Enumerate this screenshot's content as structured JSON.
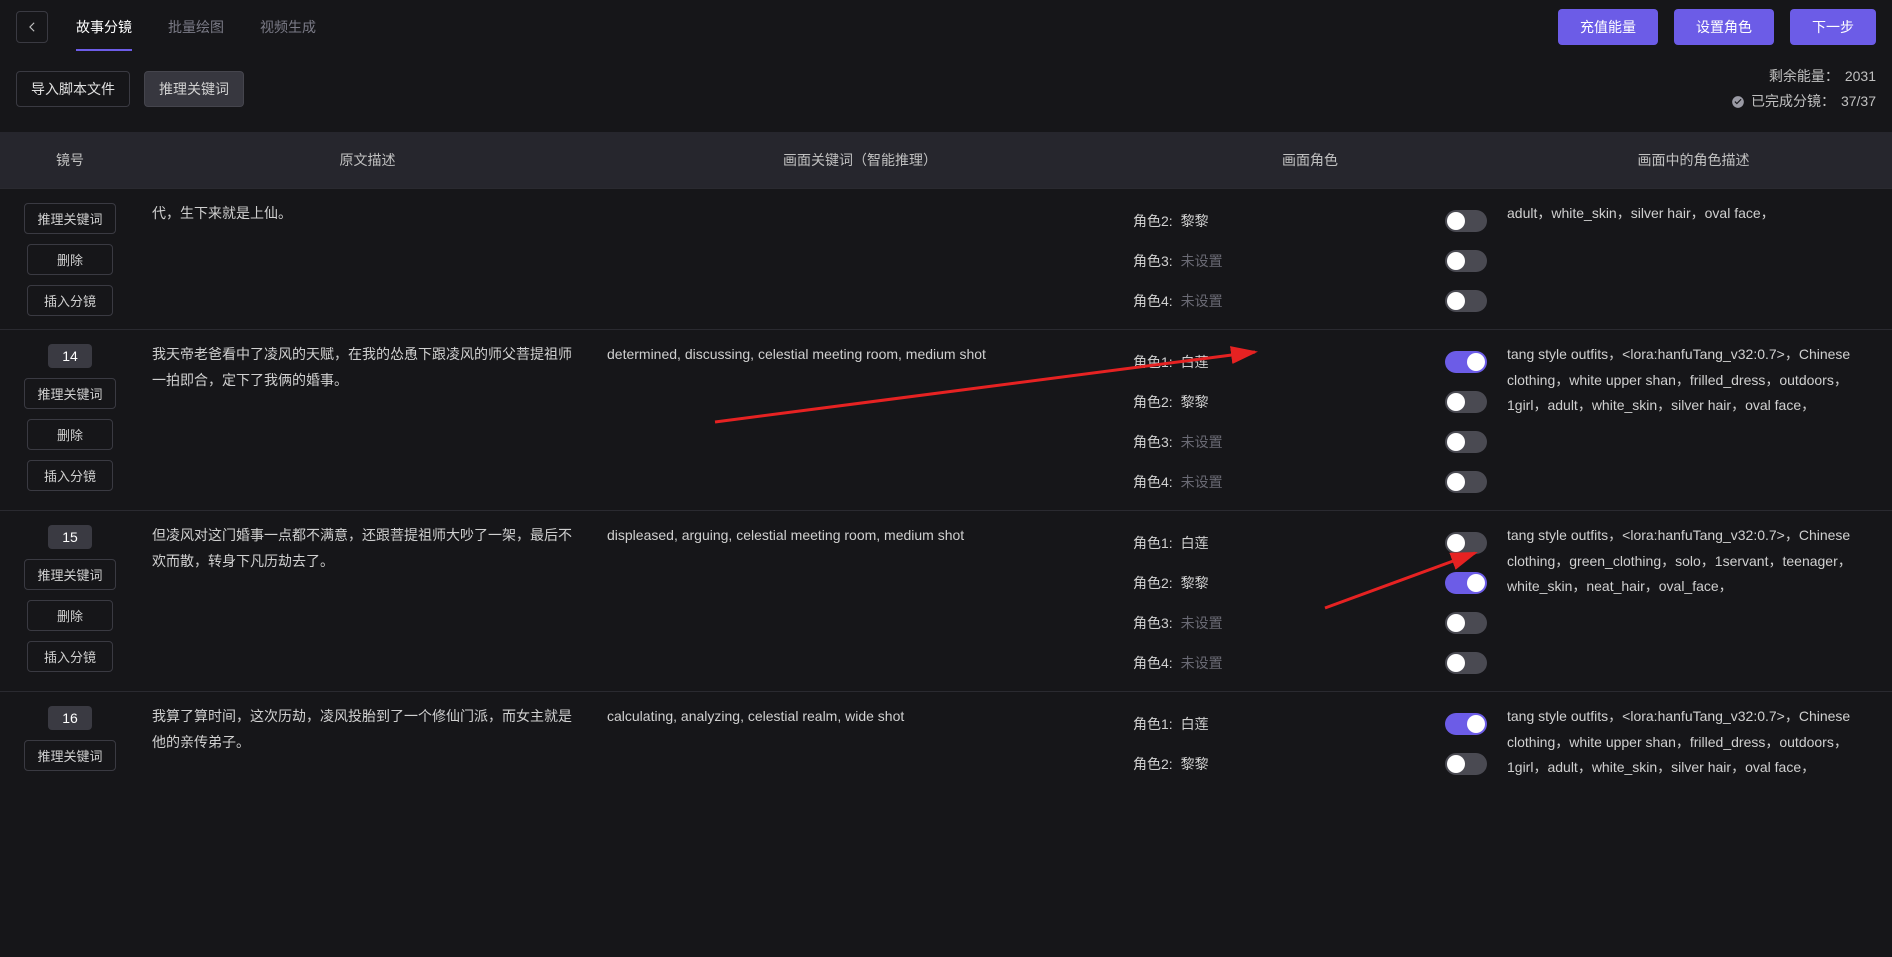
{
  "header": {
    "tabs": [
      "故事分镜",
      "批量绘图",
      "视频生成"
    ],
    "active_tab": 0,
    "buttons": {
      "recharge": "充值能量",
      "set_role": "设置角色",
      "next": "下一步"
    }
  },
  "subbar": {
    "import": "导入脚本文件",
    "infer": "推理关键词",
    "energy_label": "剩余能量：",
    "energy_value": "2031",
    "done_label": "已完成分镜：",
    "done_value": "37/37"
  },
  "columns": {
    "id": "镜号",
    "orig": "原文描述",
    "kw": "画面关键词（智能推理）",
    "role": "画面角色",
    "desc": "画面中的角色描述"
  },
  "row_buttons": {
    "infer": "推理关键词",
    "delete": "删除",
    "insert": "插入分镜"
  },
  "role_labels": {
    "prefix": "角色",
    "unset": "未设置"
  },
  "rows": [
    {
      "id": "",
      "partial_top": true,
      "orig": "代，生下来就是上仙。",
      "kw": "",
      "roles": [
        {
          "idx": 2,
          "name": "黎黎",
          "on": false
        },
        {
          "idx": 3,
          "name": "",
          "on": false
        },
        {
          "idx": 4,
          "name": "",
          "on": false
        }
      ],
      "desc": "adult，white_skin，silver hair，oval face，"
    },
    {
      "id": "14",
      "orig": "我天帝老爸看中了凌风的天赋，在我的怂恿下跟凌风的师父菩提祖师一拍即合，定下了我俩的婚事。",
      "kw": "determined, discussing, celestial meeting room, medium shot",
      "roles": [
        {
          "idx": 1,
          "name": "白莲",
          "on": true
        },
        {
          "idx": 2,
          "name": "黎黎",
          "on": false
        },
        {
          "idx": 3,
          "name": "",
          "on": false
        },
        {
          "idx": 4,
          "name": "",
          "on": false
        }
      ],
      "desc": "tang style outfits，<lora:hanfuTang_v32:0.7>，Chinese clothing，white upper shan，frilled_dress，outdoors，1girl，adult，white_skin，silver hair，oval face，",
      "arrow1": true
    },
    {
      "id": "15",
      "orig": "但凌风对这门婚事一点都不满意，还跟菩提祖师大吵了一架，最后不欢而散，转身下凡历劫去了。",
      "kw": "displeased, arguing, celestial meeting room, medium shot",
      "roles": [
        {
          "idx": 1,
          "name": "白莲",
          "on": false
        },
        {
          "idx": 2,
          "name": "黎黎",
          "on": true
        },
        {
          "idx": 3,
          "name": "",
          "on": false
        },
        {
          "idx": 4,
          "name": "",
          "on": false
        }
      ],
      "desc": "tang style outfits，<lora:hanfuTang_v32:0.7>，Chinese clothing，green_clothing，solo，1servant，teenager，white_skin，neat_hair，oval_face，",
      "arrow2": true
    },
    {
      "id": "16",
      "partial_bottom": true,
      "orig": "我算了算时间，这次历劫，凌风投胎到了一个修仙门派，而女主就是他的亲传弟子。",
      "kw": "calculating, analyzing, celestial realm, wide shot",
      "roles": [
        {
          "idx": 1,
          "name": "白莲",
          "on": true
        },
        {
          "idx": 2,
          "name": "黎黎",
          "on": false
        }
      ],
      "desc": "tang style outfits，<lora:hanfuTang_v32:0.7>，Chinese clothing，white upper shan，frilled_dress，outdoors，1girl，adult，white_skin，silver hair，oval face，"
    }
  ]
}
